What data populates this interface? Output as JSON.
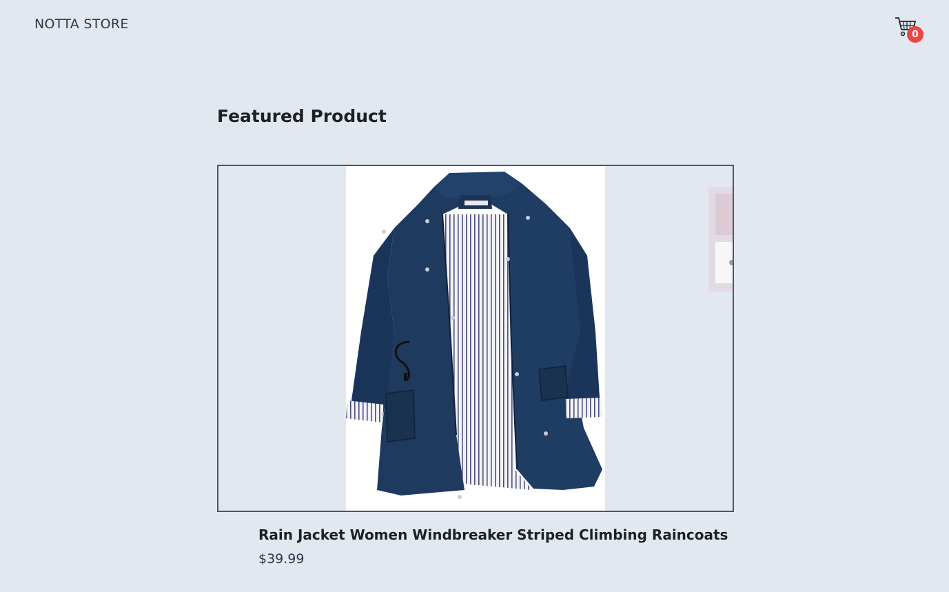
{
  "header": {
    "brand": "NOTTA STORE",
    "cart_icon": "shopping-cart-icon",
    "cart_count": "0",
    "badge_color": "#ef4444"
  },
  "main": {
    "section_title": "Featured Product",
    "product": {
      "name": "Rain Jacket Women Windbreaker Striped Climbing Raincoats",
      "price": "$39.99",
      "image_alt": "navy-rain-jacket-image"
    }
  },
  "colors": {
    "background": "#e2e8f0",
    "jacket": "#1e3a5f",
    "border": "#4a5568"
  }
}
